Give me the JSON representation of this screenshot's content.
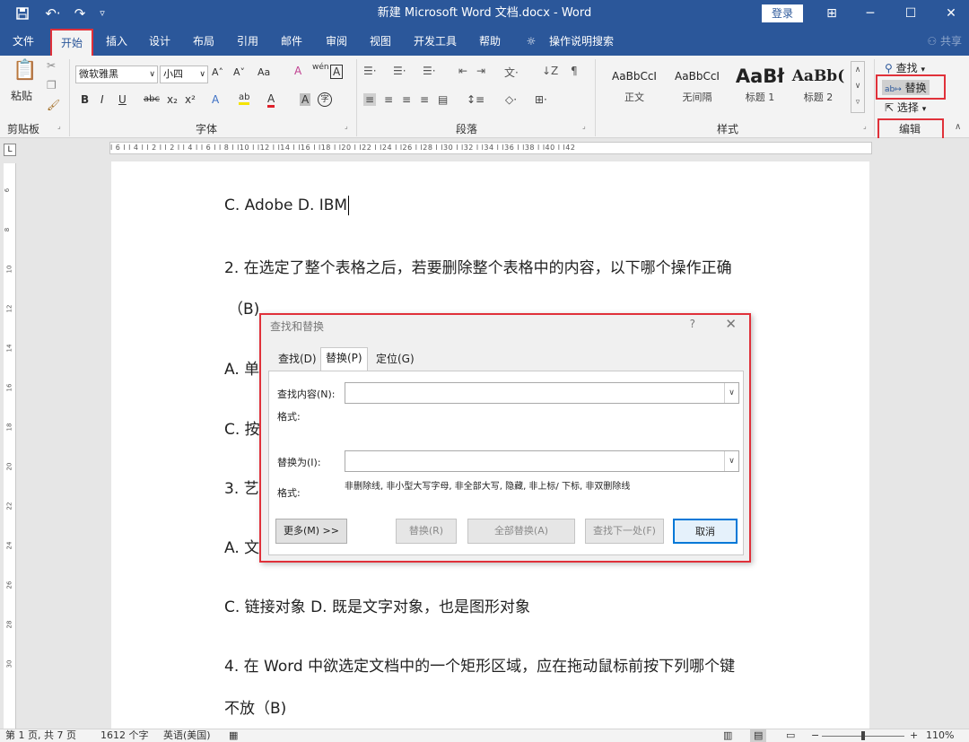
{
  "titlebar": {
    "save_icon": "save-icon",
    "undo_label": "↶·",
    "redo_label": "↷",
    "customize_label": "▿",
    "title": "新建 Microsoft Word 文档.docx  -  Word",
    "login_label": "登录",
    "ribbon_display_label": "⊞",
    "minimize_label": "─",
    "maximize_label": "☐",
    "close_label": "✕"
  },
  "tabs": [
    "文件",
    "开始",
    "插入",
    "设计",
    "布局",
    "引用",
    "邮件",
    "审阅",
    "视图",
    "开发工具",
    "帮助"
  ],
  "tell_me": "操作说明搜索",
  "share_label": "共享",
  "clipboard": {
    "paste_label": "粘贴",
    "group_label": "剪贴板"
  },
  "font": {
    "font_name": "微软雅黑",
    "font_size": "小四",
    "grow_label": "A˄",
    "shrink_label": "A˅",
    "case_label": "Aa",
    "clear_label": "A",
    "phonetic_label": "wén",
    "border_char_label": "A",
    "bold_label": "B",
    "italic_label": "I",
    "underline_label": "U",
    "strike_label": "abc",
    "sub_label": "x₂",
    "sup_label": "x²",
    "effects_label": "A",
    "highlight_label": "ab",
    "color_label": "A",
    "shade_label": "A",
    "enclose_label": "字",
    "group_label": "字体"
  },
  "paragraph": {
    "group_label": "段落"
  },
  "styles": {
    "items": [
      {
        "sample": "AaBbCcI",
        "name": "正文"
      },
      {
        "sample": "AaBbCcI",
        "name": "无间隔"
      },
      {
        "sample": "AaBł",
        "name": "标题 1"
      },
      {
        "sample": "AaBb(",
        "name": "标题 2"
      }
    ],
    "group_label": "样式"
  },
  "editing": {
    "find_label": "查找",
    "replace_label": "替换",
    "select_label": "选择",
    "group_label": "编辑"
  },
  "ruler": {
    "ticks": "l 6 l   l 4 l   l 2 l        l 2 l   l 4 l   l 6 l   l 8 l   l10 l   l12 l   l14 l   l16 l   l18 l   l20 l   l22 l   l24 l   l26 l   l28 l   l30 l   l32 l   l34 l   l36 l   l38 l   l40 l   l42"
  },
  "vruler_ticks": [
    "6",
    "8",
    "10",
    "12",
    "14",
    "16",
    "18",
    "20",
    "22",
    "24",
    "26",
    "28",
    "30"
  ],
  "document": {
    "lines": [
      "C. Adobe D. IBM",
      "2. 在选定了整个表格之后，若要删除整个表格中的内容，以下哪个操作正确",
      "（B)",
      "A. 单",
      "C. 按",
      "3. 艺",
      "A. 文",
      "C. 链接对象  D. 既是文字对象，也是图形对象",
      "4. 在  Word  中欲选定文档中的一个矩形区域，应在拖动鼠标前按下列哪个键",
      "不放（B)"
    ]
  },
  "dialog": {
    "title": "查找和替换",
    "help": "?",
    "close": "✕",
    "tabs": [
      "查找(D)",
      "替换(P)",
      "定位(G)"
    ],
    "find_label": "查找内容(N):",
    "find_value": "",
    "find_format_label": "格式:",
    "replace_label": "替换为(I):",
    "replace_value": "",
    "replace_format_label": "格式:",
    "replace_format_value": "非删除线, 非小型大写字母, 非全部大写, 隐藏, 非上标/ 下标, 非双删除线",
    "more_button": "更多(M) >>",
    "replace_button": "替换(R)",
    "replace_all_button": "全部替换(A)",
    "find_next_button": "查找下一处(F)",
    "cancel_button": "取消"
  },
  "statusbar": {
    "page": "第 1 页, 共 7 页",
    "words": "1612 个字",
    "language": "英语(美国)",
    "zoom": "110%"
  },
  "colors": {
    "accent": "#2b579a",
    "highlight_box": "#e0313a"
  }
}
